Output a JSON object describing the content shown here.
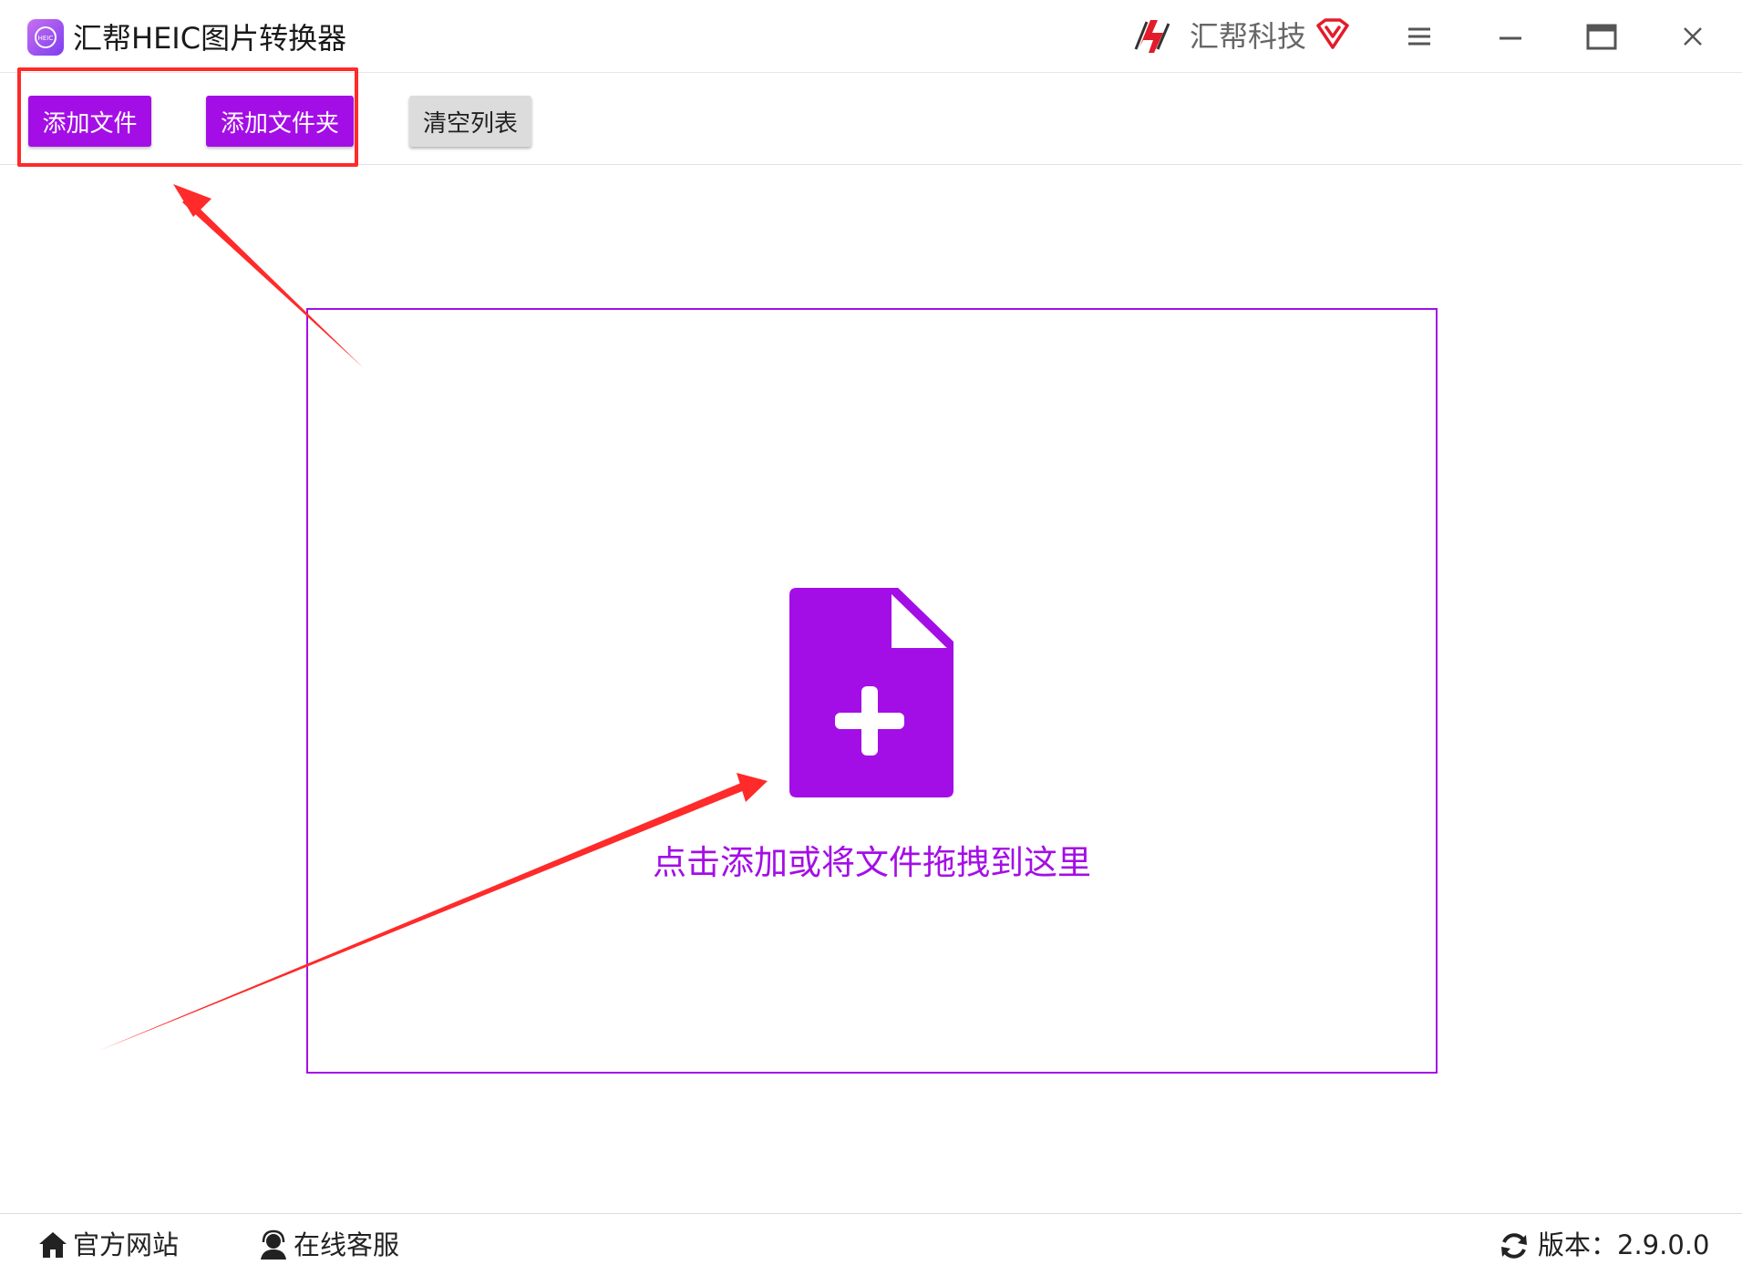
{
  "window": {
    "title": "汇帮HEIC图片转换器",
    "brand": "汇帮科技",
    "controls": [
      "menu-icon",
      "minimize-icon",
      "maximize-icon",
      "close-icon"
    ]
  },
  "toolbar": {
    "add_file_label": "添加文件",
    "add_folder_label": "添加文件夹",
    "clear_list_label": "清空列表"
  },
  "dropzone": {
    "hint": "点击添加或将文件拖拽到这里",
    "icon": "file-add-icon"
  },
  "statusbar": {
    "website_label": "官方网站",
    "support_label": "在线客服",
    "version_label": "版本：2.9.0.0"
  },
  "colors": {
    "accent": "#a40ee6",
    "annotation": "#ff2a2a",
    "secondary_button": "#dcdcdc"
  }
}
